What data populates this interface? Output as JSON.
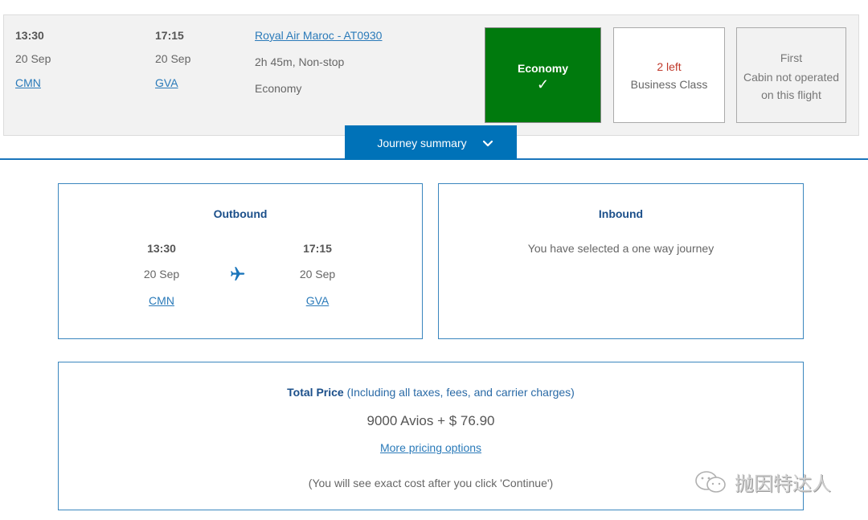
{
  "flight": {
    "departure": {
      "time": "13:30",
      "date": "20 Sep",
      "airport": "CMN"
    },
    "arrival": {
      "time": "17:15",
      "date": "20 Sep",
      "airport": "GVA"
    },
    "flight_link": "Royal Air Maroc - AT0930",
    "duration": "2h 45m, Non-stop",
    "cabin": "Economy"
  },
  "cabins": {
    "economy": {
      "label": "Economy",
      "selected": true,
      "check_icon": "✓",
      "color": "#007a0d"
    },
    "business": {
      "availability": "2 left",
      "label": "Business Class"
    },
    "first": {
      "label": "First",
      "note_line1": "Cabin not operated",
      "note_line2": "on this flight"
    }
  },
  "journey_summary": {
    "label": "Journey summary",
    "icon": "chevron-down-icon",
    "color": "#0072b8"
  },
  "outbound": {
    "title": "Outbound",
    "departure": {
      "time": "13:30",
      "date": "20 Sep",
      "airport": "CMN"
    },
    "arrival": {
      "time": "17:15",
      "date": "20 Sep",
      "airport": "GVA"
    },
    "icon": "plane-icon"
  },
  "inbound": {
    "title": "Inbound",
    "message": "You have selected a one way journey"
  },
  "price": {
    "label_bold": "Total Price",
    "label_rest": " (Including all taxes, fees, and carrier charges)",
    "value": "9000 Avios + $ 76.90",
    "more_options": "More pricing options",
    "note": "(You will see exact cost after you click 'Continue')"
  },
  "watermark": {
    "text": "抛因特达人",
    "icon": "wechat-icon"
  }
}
